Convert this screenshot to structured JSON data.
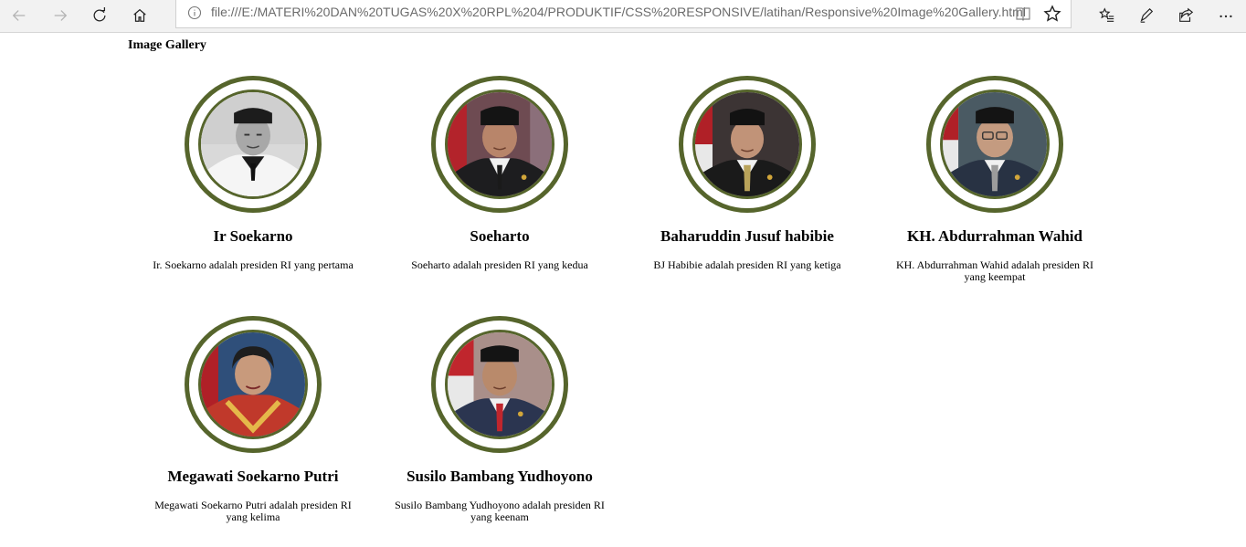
{
  "browser": {
    "url": "file:///E:/MATERI%20DAN%20TUGAS%20X%20RPL%204/PRODUKTIF/CSS%20RESPONSIVE/latihan/Responsive%20Image%20Gallery.html",
    "icons": [
      "back-icon",
      "forward-icon",
      "refresh-icon",
      "home-icon",
      "info-icon",
      "reading-view-icon",
      "favorite-star-icon",
      "favorites-hub-icon",
      "pen-icon",
      "share-icon",
      "more-icon"
    ]
  },
  "page": {
    "title": "Image Gallery"
  },
  "gallery": [
    {
      "name": "Ir Soekarno",
      "description": "Ir. Soekarno adalah presiden RI yang pertama"
    },
    {
      "name": "Soeharto",
      "description": "Soeharto adalah presiden RI yang kedua"
    },
    {
      "name": "Baharuddin Jusuf habibie",
      "description": "BJ Habibie adalah presiden RI yang ketiga"
    },
    {
      "name": "KH. Abdurrahman Wahid",
      "description": "KH. Abdurrahman Wahid adalah presiden RI yang keempat"
    },
    {
      "name": "Megawati Soekarno Putri",
      "description": "Megawati Soekarno Putri adalah presiden RI yang kelima"
    },
    {
      "name": "Susilo Bambang Yudhoyono",
      "description": "Susilo Bambang Yudhoyono adalah presiden RI yang keenam"
    }
  ],
  "colors": {
    "frame": "#56652c",
    "toolbar": "#f2f2f2"
  }
}
